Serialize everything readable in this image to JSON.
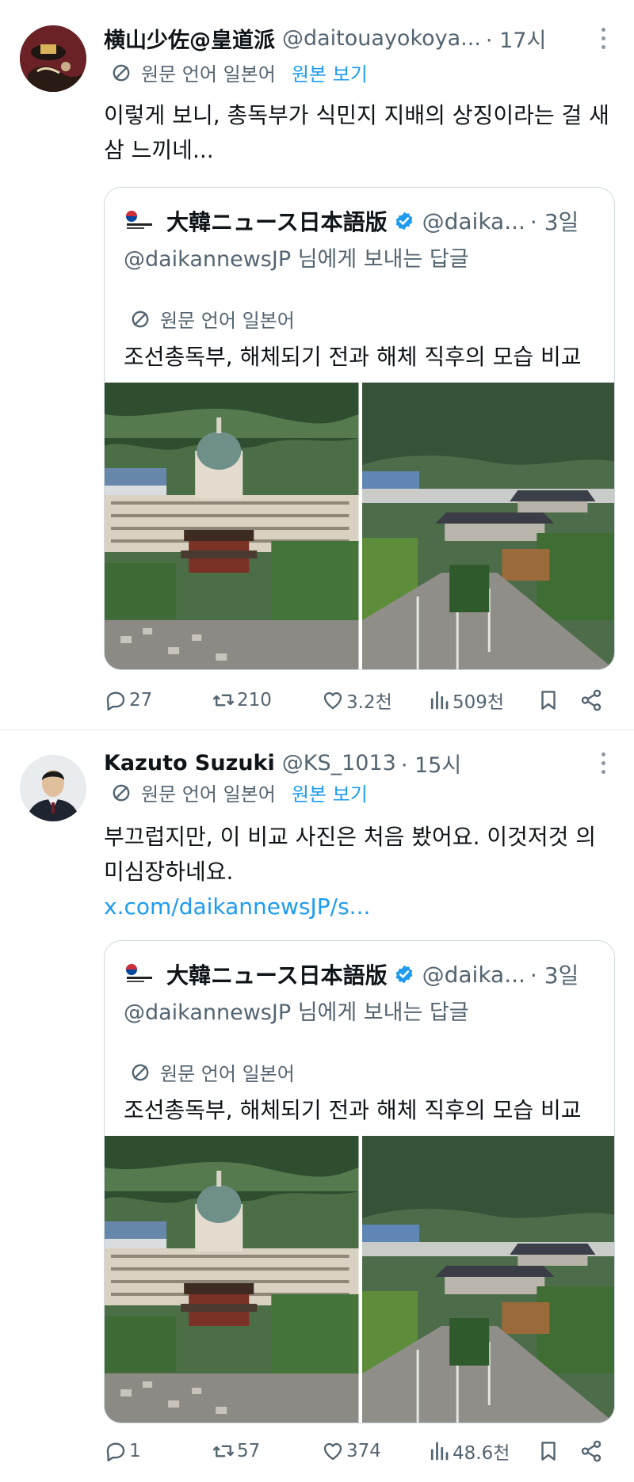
{
  "translation_label": "원문 언어 일본어",
  "show_original_label": "원본 보기",
  "tweets": [
    {
      "author_name": "横山少佐@皇道派",
      "handle": "@daitouayokoya...",
      "time": "· 17시",
      "text": "이렇게 보니, 총독부가 식민지 지배의 상징이라는 걸 새삼 느끼네...",
      "link": "",
      "quote": {
        "name": "大韓ニュース日本語版",
        "handle": "@daika...",
        "time": "· 3일",
        "reply_to": "@daikannewsJP 님에게 보내는 답글",
        "text": "조선총독부, 해체되기 전과 해체 직후의 모습 비교"
      },
      "stats": {
        "replies": "27",
        "reposts": "210",
        "likes": "3.2천",
        "views": "509천"
      }
    },
    {
      "author_name": "Kazuto Suzuki",
      "handle": "@KS_1013",
      "time": "· 15시",
      "text": "부끄럽지만, 이 비교 사진은 처음 봤어요. 이것저것 의미심장하네요.",
      "link": "x.com/daikannewsJP/s...",
      "quote": {
        "name": "大韓ニュース日本語版",
        "handle": "@daika...",
        "time": "· 3일",
        "reply_to": "@daikannewsJP 님에게 보내는 답글",
        "text": "조선총독부, 해체되기 전과 해체 직후의 모습 비교"
      },
      "stats": {
        "replies": "1",
        "reposts": "57",
        "likes": "374",
        "views": "48.6천"
      }
    }
  ],
  "colors": {
    "accent": "#1d9bf0",
    "secondary_text": "#536471",
    "border": "#cfd9de"
  }
}
